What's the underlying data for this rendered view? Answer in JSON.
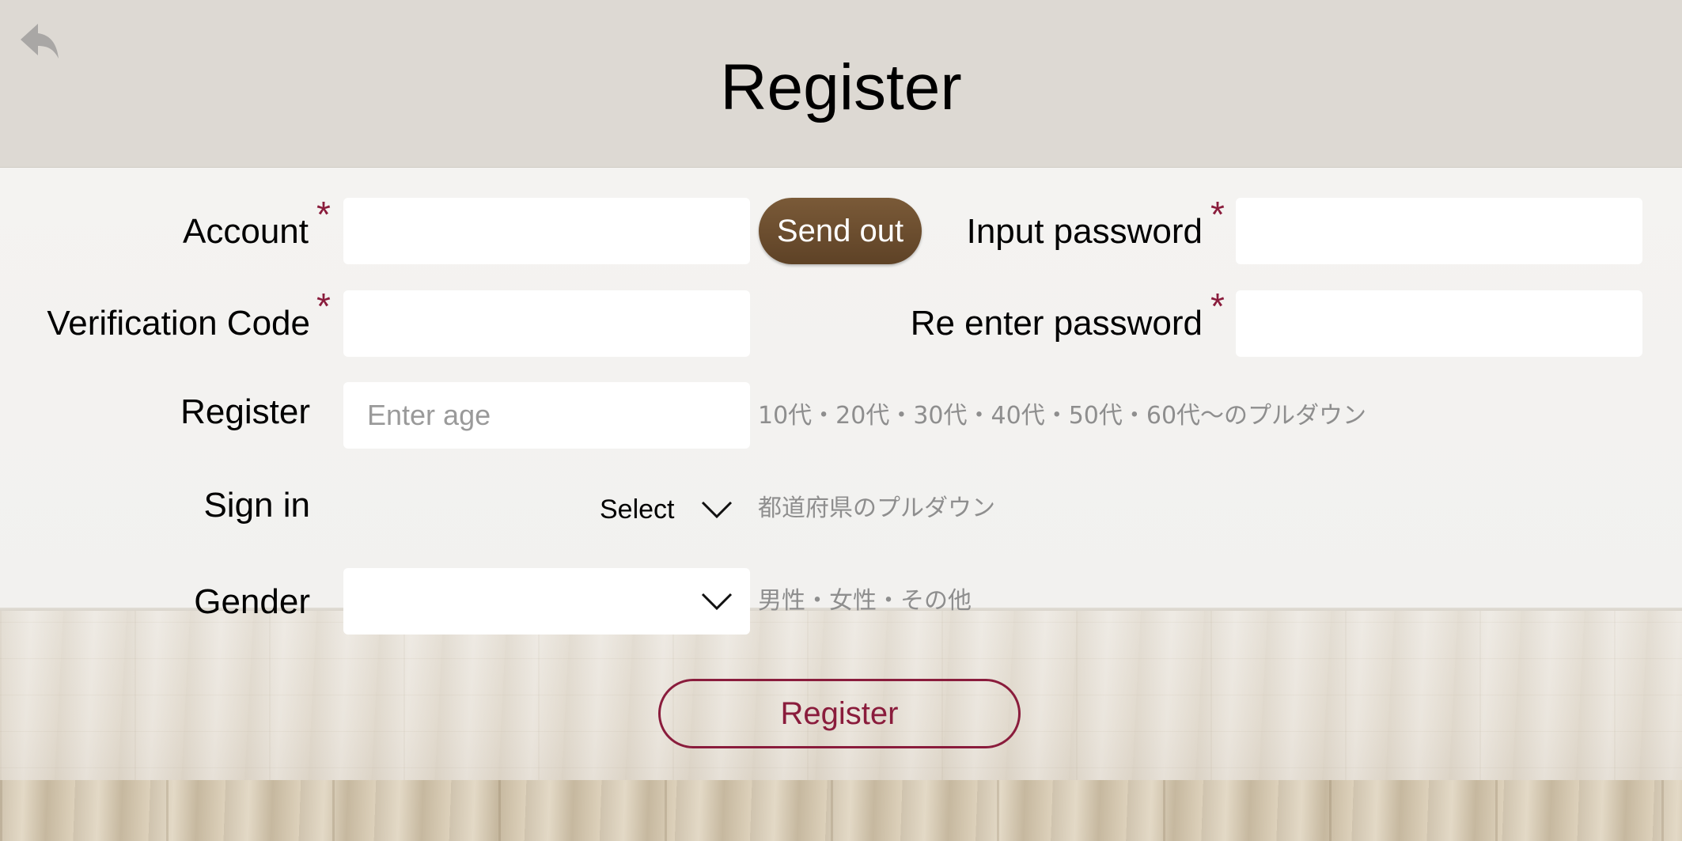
{
  "header": {
    "title": "Register",
    "back_icon": "back-arrow-icon"
  },
  "form": {
    "account": {
      "label": "Account",
      "required_mark": "*",
      "value": ""
    },
    "send_button": {
      "label": "Send out"
    },
    "input_password": {
      "label": "Input password",
      "required_mark": "*",
      "value": ""
    },
    "verification_code": {
      "label": "Verification Code",
      "required_mark": "*",
      "value": ""
    },
    "reenter_password": {
      "label": "Re enter password",
      "required_mark": "*",
      "value": ""
    },
    "age": {
      "label": "Register",
      "placeholder": "Enter age",
      "hint": "10代・20代・30代・40代・50代・60代〜のプルダウン"
    },
    "prefecture": {
      "label": "Sign in",
      "selected": "Select",
      "hint": "都道府県のプルダウン"
    },
    "gender": {
      "label": "Gender",
      "selected": "",
      "hint": "男性・女性・その他"
    },
    "register_button": {
      "label": "Register"
    }
  },
  "colors": {
    "header_bg": "#ddd9d3",
    "required": "#8a1c3c",
    "send_button": "#6b4c2e",
    "register_border": "#8a1c3c"
  }
}
